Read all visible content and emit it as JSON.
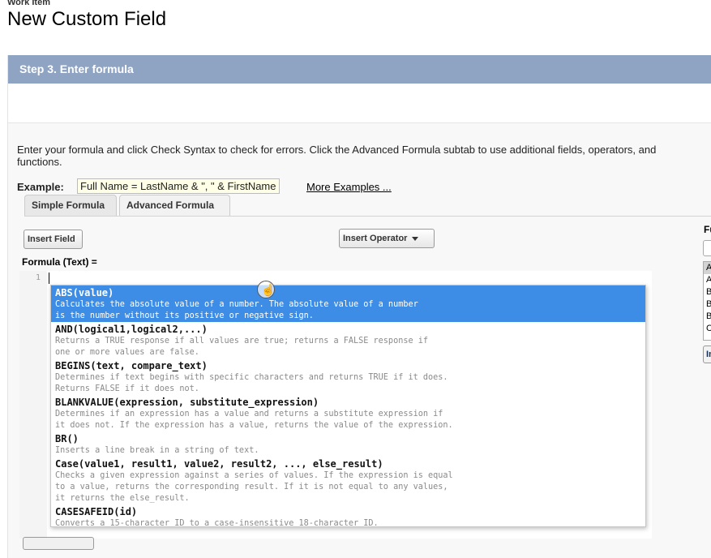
{
  "header": {
    "pre_title": "Work Item",
    "title": "New Custom Field"
  },
  "step": {
    "title": "Step 3. Enter formula"
  },
  "instructions": {
    "line1": "Enter your formula and click Check Syntax to check for errors. Click the Advanced Formula subtab to use additional fields, operators, and",
    "line2": "functions."
  },
  "example": {
    "label": "Example:",
    "value": "Full Name = LastName & \", \" & FirstName",
    "more_link": "More Examples ..."
  },
  "tabs": [
    {
      "label": "Simple Formula"
    },
    {
      "label": "Advanced Formula"
    }
  ],
  "toolbar": {
    "insert_field": "Insert Field",
    "insert_operator": "Insert Operator"
  },
  "formula": {
    "label": "Formula (Text) =",
    "line_number": "1"
  },
  "autocomplete": [
    {
      "signature": "ABS(value)",
      "description": "Calculates the absolute value of a number. The absolute value of a number\nis the number without its positive or negative sign.",
      "selected": true
    },
    {
      "signature": "AND(logical1,logical2,...)",
      "description": "Returns a TRUE response if all values are true; returns a FALSE response if\none or more values are false."
    },
    {
      "signature": "BEGINS(text, compare_text)",
      "description": "Determines if text begins with specific characters and returns TRUE if it does.\nReturns FALSE if it does not."
    },
    {
      "signature": "BLANKVALUE(expression, substitute_expression)",
      "description": "Determines if an expression has a value and returns a substitute expression if\nit does not. If the expression has a value, returns the value of the expression."
    },
    {
      "signature": "BR()",
      "description": "Inserts a line break in a string of text."
    },
    {
      "signature": "Case(value1, result1, value2, result2, ..., else_result)",
      "description": "Checks a given expression against a series of values. If the expression is equal\nto a value, returns the corresponding result. If it is not equal to any values,\nit returns the else_result."
    },
    {
      "signature": "CASESAFEID(id)",
      "description": "Converts a 15-character ID to a case-insensitive 18-character ID."
    }
  ],
  "right_column": {
    "label": "Fu",
    "options": [
      "A",
      "A",
      "B",
      "B",
      "B",
      "C"
    ],
    "button": "In"
  },
  "colors": {
    "step_bar": "#8fa3c2",
    "selected": "#3d8de6"
  }
}
